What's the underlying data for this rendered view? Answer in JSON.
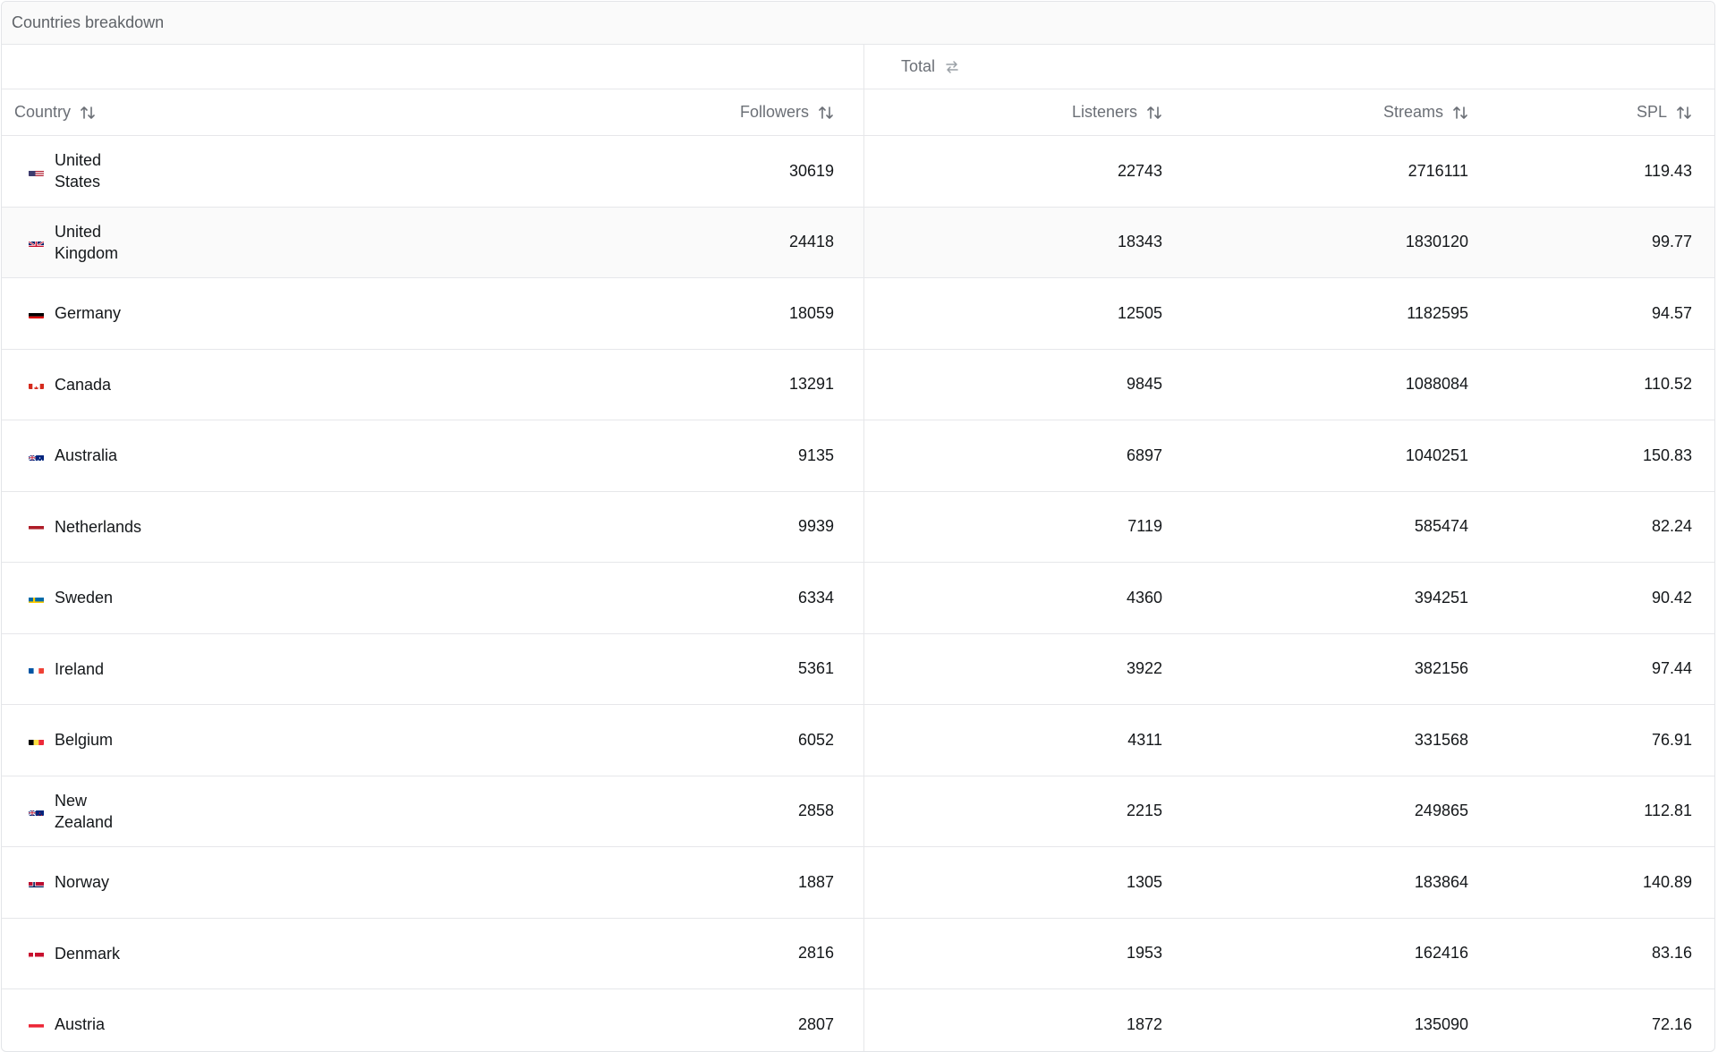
{
  "card": {
    "title": "Countries breakdown"
  },
  "group_header": {
    "total_label": "Total",
    "swap_icon": "swap-arrows-icon"
  },
  "columns": {
    "country": "Country",
    "followers": "Followers",
    "listeners": "Listeners",
    "streams": "Streams",
    "spl": "SPL",
    "sort_icon": "sort-arrows-icon"
  },
  "rows": [
    {
      "country": "United States",
      "flag": "us-flag-icon",
      "followers": "30619",
      "listeners": "22743",
      "streams": "2716111",
      "spl": "119.43"
    },
    {
      "country": "United Kingdom",
      "flag": "gb-flag-icon",
      "followers": "24418",
      "listeners": "18343",
      "streams": "1830120",
      "spl": "99.77"
    },
    {
      "country": "Germany",
      "flag": "de-flag-icon",
      "followers": "18059",
      "listeners": "12505",
      "streams": "1182595",
      "spl": "94.57"
    },
    {
      "country": "Canada",
      "flag": "ca-flag-icon",
      "followers": "13291",
      "listeners": "9845",
      "streams": "1088084",
      "spl": "110.52"
    },
    {
      "country": "Australia",
      "flag": "au-flag-icon",
      "followers": "9135",
      "listeners": "6897",
      "streams": "1040251",
      "spl": "150.83"
    },
    {
      "country": "Netherlands",
      "flag": "nl-flag-icon",
      "followers": "9939",
      "listeners": "7119",
      "streams": "585474",
      "spl": "82.24"
    },
    {
      "country": "Sweden",
      "flag": "se-flag-icon",
      "followers": "6334",
      "listeners": "4360",
      "streams": "394251",
      "spl": "90.42"
    },
    {
      "country": "Ireland",
      "flag": "ie-flag-icon",
      "followers": "5361",
      "listeners": "3922",
      "streams": "382156",
      "spl": "97.44"
    },
    {
      "country": "Belgium",
      "flag": "be-flag-icon",
      "followers": "6052",
      "listeners": "4311",
      "streams": "331568",
      "spl": "76.91"
    },
    {
      "country": "New Zealand",
      "flag": "nz-flag-icon",
      "followers": "2858",
      "listeners": "2215",
      "streams": "249865",
      "spl": "112.81"
    },
    {
      "country": "Norway",
      "flag": "no-flag-icon",
      "followers": "1887",
      "listeners": "1305",
      "streams": "183864",
      "spl": "140.89"
    },
    {
      "country": "Denmark",
      "flag": "dk-flag-icon",
      "followers": "2816",
      "listeners": "1953",
      "streams": "162416",
      "spl": "83.16"
    },
    {
      "country": "Austria",
      "flag": "at-flag-icon",
      "followers": "2807",
      "listeners": "1872",
      "streams": "135090",
      "spl": "72.16"
    }
  ],
  "colors": {
    "border": "#e6e7ea",
    "header_bg": "#fafafa",
    "muted_text": "#6b6f76",
    "text": "#14171a"
  }
}
